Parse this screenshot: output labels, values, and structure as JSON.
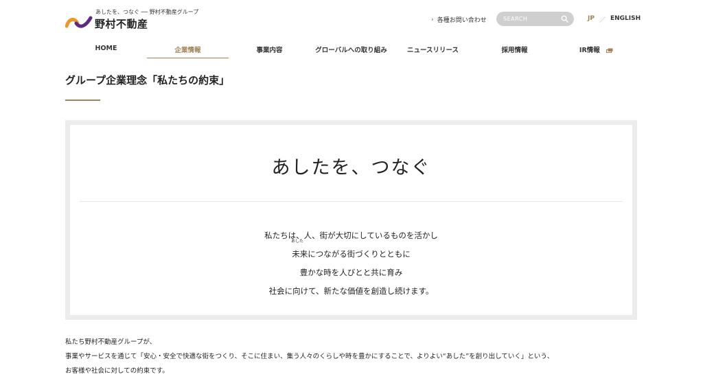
{
  "header": {
    "tagline": "あしたを、つなぐ ── 野村不動産グループ",
    "brand": "野村不動産",
    "contact_label": "各種お問い合わせ",
    "search_placeholder": "SEARCH",
    "lang_jp": "JP",
    "lang_sep": "／",
    "lang_en": "ENGLISH"
  },
  "nav": {
    "items": [
      {
        "label": "HOME"
      },
      {
        "label": "企業情報"
      },
      {
        "label": "事業内容"
      },
      {
        "label": "グローバルへの取り組み"
      },
      {
        "label": "ニュースリリース"
      },
      {
        "label": "採用情報"
      },
      {
        "label": "IR情報"
      }
    ]
  },
  "page": {
    "title": "グループ企業理念「私たちの約束」"
  },
  "promise": {
    "heading": "あしたを、つなぐ",
    "ruby": "あした",
    "lines": [
      "私たちは、人、街が大切にしているものを活かし",
      "未来につながる街づくりとともに",
      "豊かな時を人びとと共に育み",
      "社会に向けて、新たな価値を創造し続けます。"
    ]
  },
  "body": {
    "lines": [
      "私たち野村不動産グループが、",
      "事業やサービスを通じて「安心・安全で快適な街をつくり、そこに住まい、集う人々のくらしや時を豊かにすることで、よりよい“あした”を創り出していく」という、",
      "お客様や社会に対しての約束です。"
    ]
  },
  "colors": {
    "accent": "#a08357",
    "frame": "#ececec",
    "search_bg": "#cfcfcf",
    "logo_orange": "#f0962c",
    "logo_purple": "#5d2a84"
  },
  "icons": {
    "contact": "chevron-right-icon",
    "search": "search-icon",
    "ir": "external-window-icon"
  }
}
